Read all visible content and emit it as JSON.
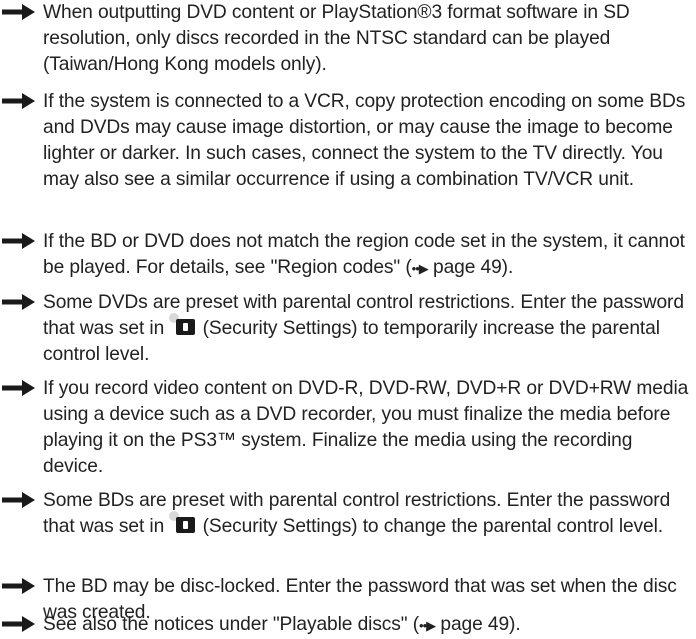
{
  "notes": [
    {
      "text": "When outputting DVD content or PlayStation®3 format software in SD resolution, only discs recorded in the NTSC standard can be played (Taiwan/Hong Kong models only)."
    },
    {
      "text": "If the system is connected to a VCR, copy protection encoding on some BDs and DVDs may cause image distortion, or may cause the image to become lighter or darker. In such cases, connect the system to the TV directly. You may also see a similar occurrence if using a combination TV/VCR unit."
    },
    {
      "before": "If the BD or DVD does not match the region code set in the system, it cannot be played. For details, see \"Region codes\" (",
      "arrow": "••▶",
      "page": " page 49",
      "after": ")."
    },
    {
      "before": "Some DVDs are preset with parental control restrictions. Enter the password that was set in ",
      "icon": "security-settings-icon",
      "after": " (Security Settings) to temporarily increase the parental control level."
    },
    {
      "text": "If you record video content on DVD-R, DVD-RW, DVD+R or DVD+RW media using a device such as a DVD recorder, you must finalize the media before playing it on the PS3™ system. Finalize the media using the recording device."
    },
    {
      "before": "Some BDs are preset with parental control restrictions. Enter the password that was set in ",
      "icon": "security-settings-icon",
      "after": " (Security Settings) to change the parental control level."
    },
    {
      "text": "The BD may be disc-locked. Enter the password that was set when the disc was created."
    },
    {
      "before": "See also the notices under \"Playable discs\" (",
      "arrow": "••▶",
      "page": " page 49",
      "after": ")."
    }
  ],
  "colors": {
    "arrow": "#1a1a1a",
    "text": "#222222"
  }
}
